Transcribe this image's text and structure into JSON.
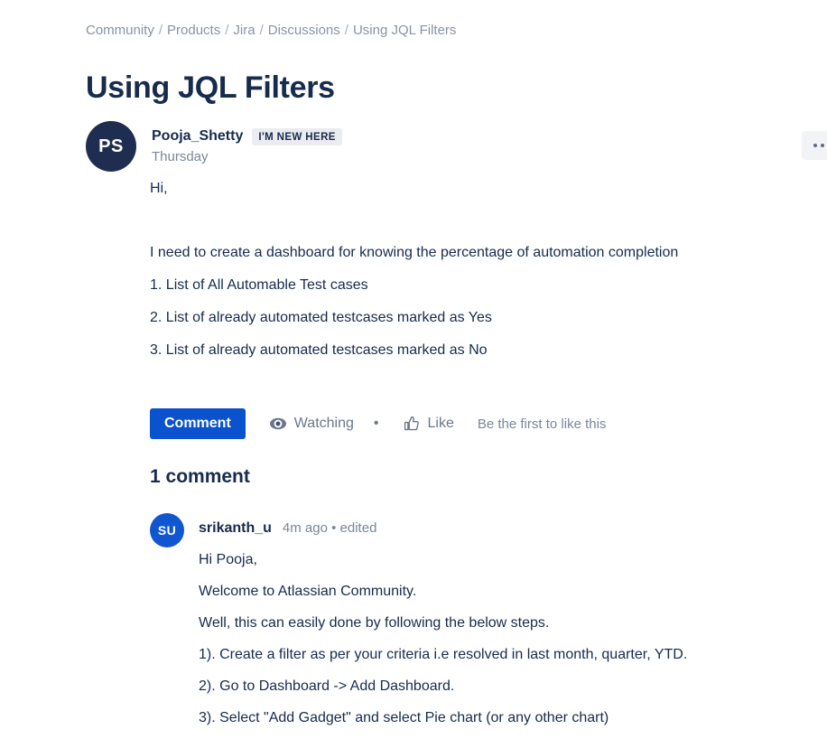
{
  "breadcrumb": {
    "separator": "/",
    "items": [
      {
        "label": "Community"
      },
      {
        "label": "Products"
      },
      {
        "label": "Jira"
      },
      {
        "label": "Discussions"
      },
      {
        "label": "Using JQL Filters"
      }
    ]
  },
  "page_title": "Using JQL Filters",
  "post": {
    "avatar_initials": "PS",
    "avatar_color": "#1F2D50",
    "author": "Pooja_Shetty",
    "badge": "I'M NEW HERE",
    "date": "Thursday",
    "paragraphs": [
      "Hi,",
      " I need to create a dashboard for knowing the percentage of automation completion",
      "1. List of All Automable Test cases",
      "2. List of already automated testcases marked as Yes",
      "3. List of already automated testcases marked as No"
    ]
  },
  "actions": {
    "comment_label": "Comment",
    "watching_label": "Watching",
    "separator": "•",
    "like_label": "Like",
    "like_note": "Be the first to like this",
    "comment_button_color": "#0B52CE"
  },
  "comments": {
    "heading": "1 comment",
    "list": [
      {
        "avatar_initials": "SU",
        "avatar_color": "#1056D0",
        "author": "srikanth_u",
        "time": "4m ago • edited",
        "paragraphs": [
          "Hi Pooja,",
          "Welcome to Atlassian Community.",
          "Well, this can easily done by following the below steps.",
          "1). Create a filter as per your criteria i.e resolved in last month, quarter, YTD.",
          "2). Go to Dashboard -> Add Dashboard.",
          "3). Select \"Add Gadget\" and select Pie chart (or any other chart)"
        ]
      }
    ]
  },
  "overflow_menu": {
    "icon": "ellipsis-icon"
  }
}
